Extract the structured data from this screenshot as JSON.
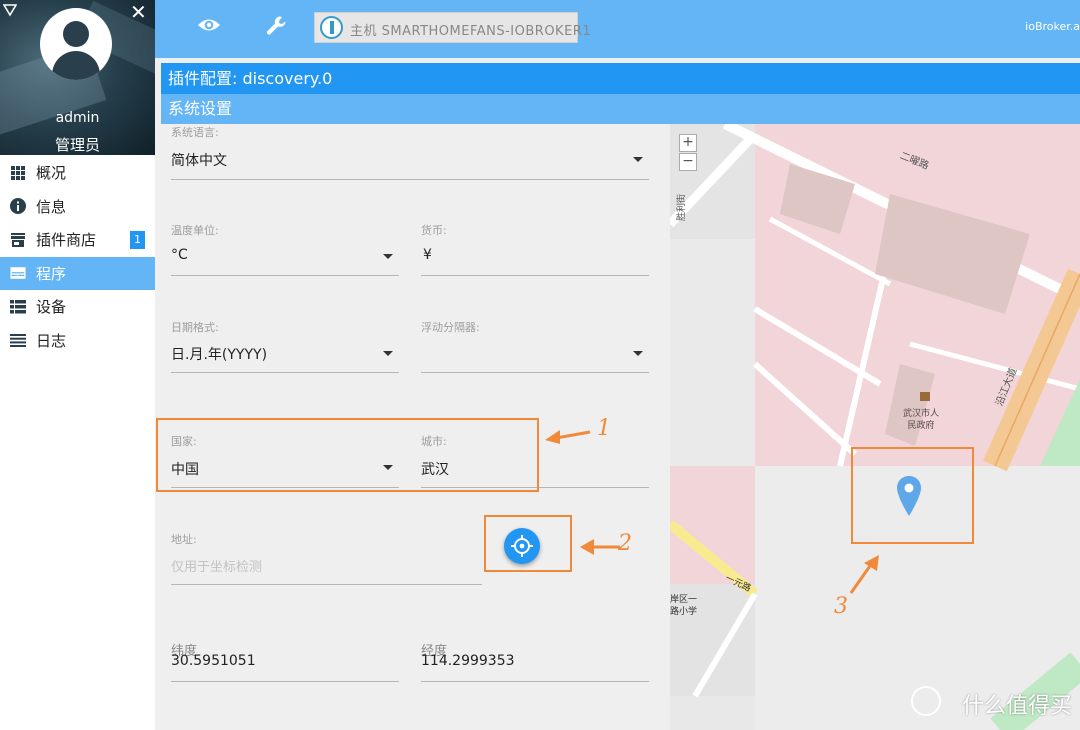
{
  "user": {
    "name": "admin",
    "role": "管理员"
  },
  "nav": {
    "items": [
      {
        "label": "概况",
        "icon": "grid-icon"
      },
      {
        "label": "信息",
        "icon": "info-icon"
      },
      {
        "label": "插件商店",
        "icon": "store-icon",
        "badge": "1"
      },
      {
        "label": "程序",
        "icon": "program-icon",
        "active": true
      },
      {
        "label": "设备",
        "icon": "device-list-icon"
      },
      {
        "label": "日志",
        "icon": "log-icon"
      }
    ]
  },
  "topbar": {
    "host": "主机 SMARTHOMEFANS-IOBROKER1",
    "brand": "ioBroker.a"
  },
  "header": {
    "title": "插件配置: discovery.0",
    "subtitle": "系统设置"
  },
  "form": {
    "language": {
      "label": "系统语言:",
      "value": "简体中文"
    },
    "temp_unit": {
      "label": "温度单位:",
      "value": "°C"
    },
    "currency": {
      "label": "货币:",
      "value": "¥"
    },
    "date_format": {
      "label": "日期格式:",
      "value": "日.月.年(YYYY)"
    },
    "float_sep": {
      "label": "浮动分隔器:",
      "value": ""
    },
    "country": {
      "label": "国家:",
      "value": "中国"
    },
    "city": {
      "label": "城市:",
      "value": "武汉"
    },
    "address": {
      "label": "地址:",
      "placeholder": "仅用于坐标检测"
    },
    "latitude": {
      "label": "纬度",
      "value": "30.5951051"
    },
    "longitude": {
      "label": "经度",
      "value": "114.2999353"
    }
  },
  "map": {
    "zoom_in": "+",
    "zoom_out": "−",
    "labels": {
      "road1": "二曜路",
      "road2": "胜利街",
      "road3": "沿江大道",
      "road4": "一元路",
      "building": "武汉市人民政府",
      "building_line1": "武汉市人",
      "building_line2": "民政府",
      "school1": "岸区一",
      "school2": "路小学"
    }
  },
  "annotations": [
    "1",
    "2",
    "3"
  ],
  "watermark": "什么值得买",
  "colors": {
    "accent": "#2196f3",
    "light_accent": "#64b5f6",
    "annotation": "#f08a3a"
  }
}
